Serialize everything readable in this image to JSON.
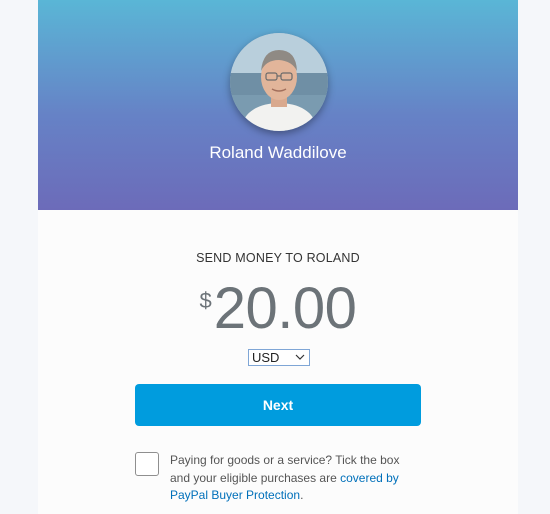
{
  "recipient": {
    "name": "Roland Waddilove",
    "avatar_alt": "profile photo"
  },
  "payment": {
    "send_to_label": "SEND MONEY TO ROLAND",
    "currency_symbol": "$",
    "amount": "20.00",
    "currency": "USD"
  },
  "actions": {
    "next_label": "Next"
  },
  "protection": {
    "text": "Paying for goods or a service? Tick the box and your eligible purchases are ",
    "link_text": "covered by PayPal Buyer Protection",
    "trailing": ".",
    "checked": false
  },
  "colors": {
    "header_top": "#5ab6d6",
    "header_bottom": "#6c6bb9",
    "primary_button": "#009cde",
    "link": "#0070ba",
    "amount_text": "#6c7378"
  },
  "icons": {
    "currency_dropdown": "chevron-down-icon"
  }
}
